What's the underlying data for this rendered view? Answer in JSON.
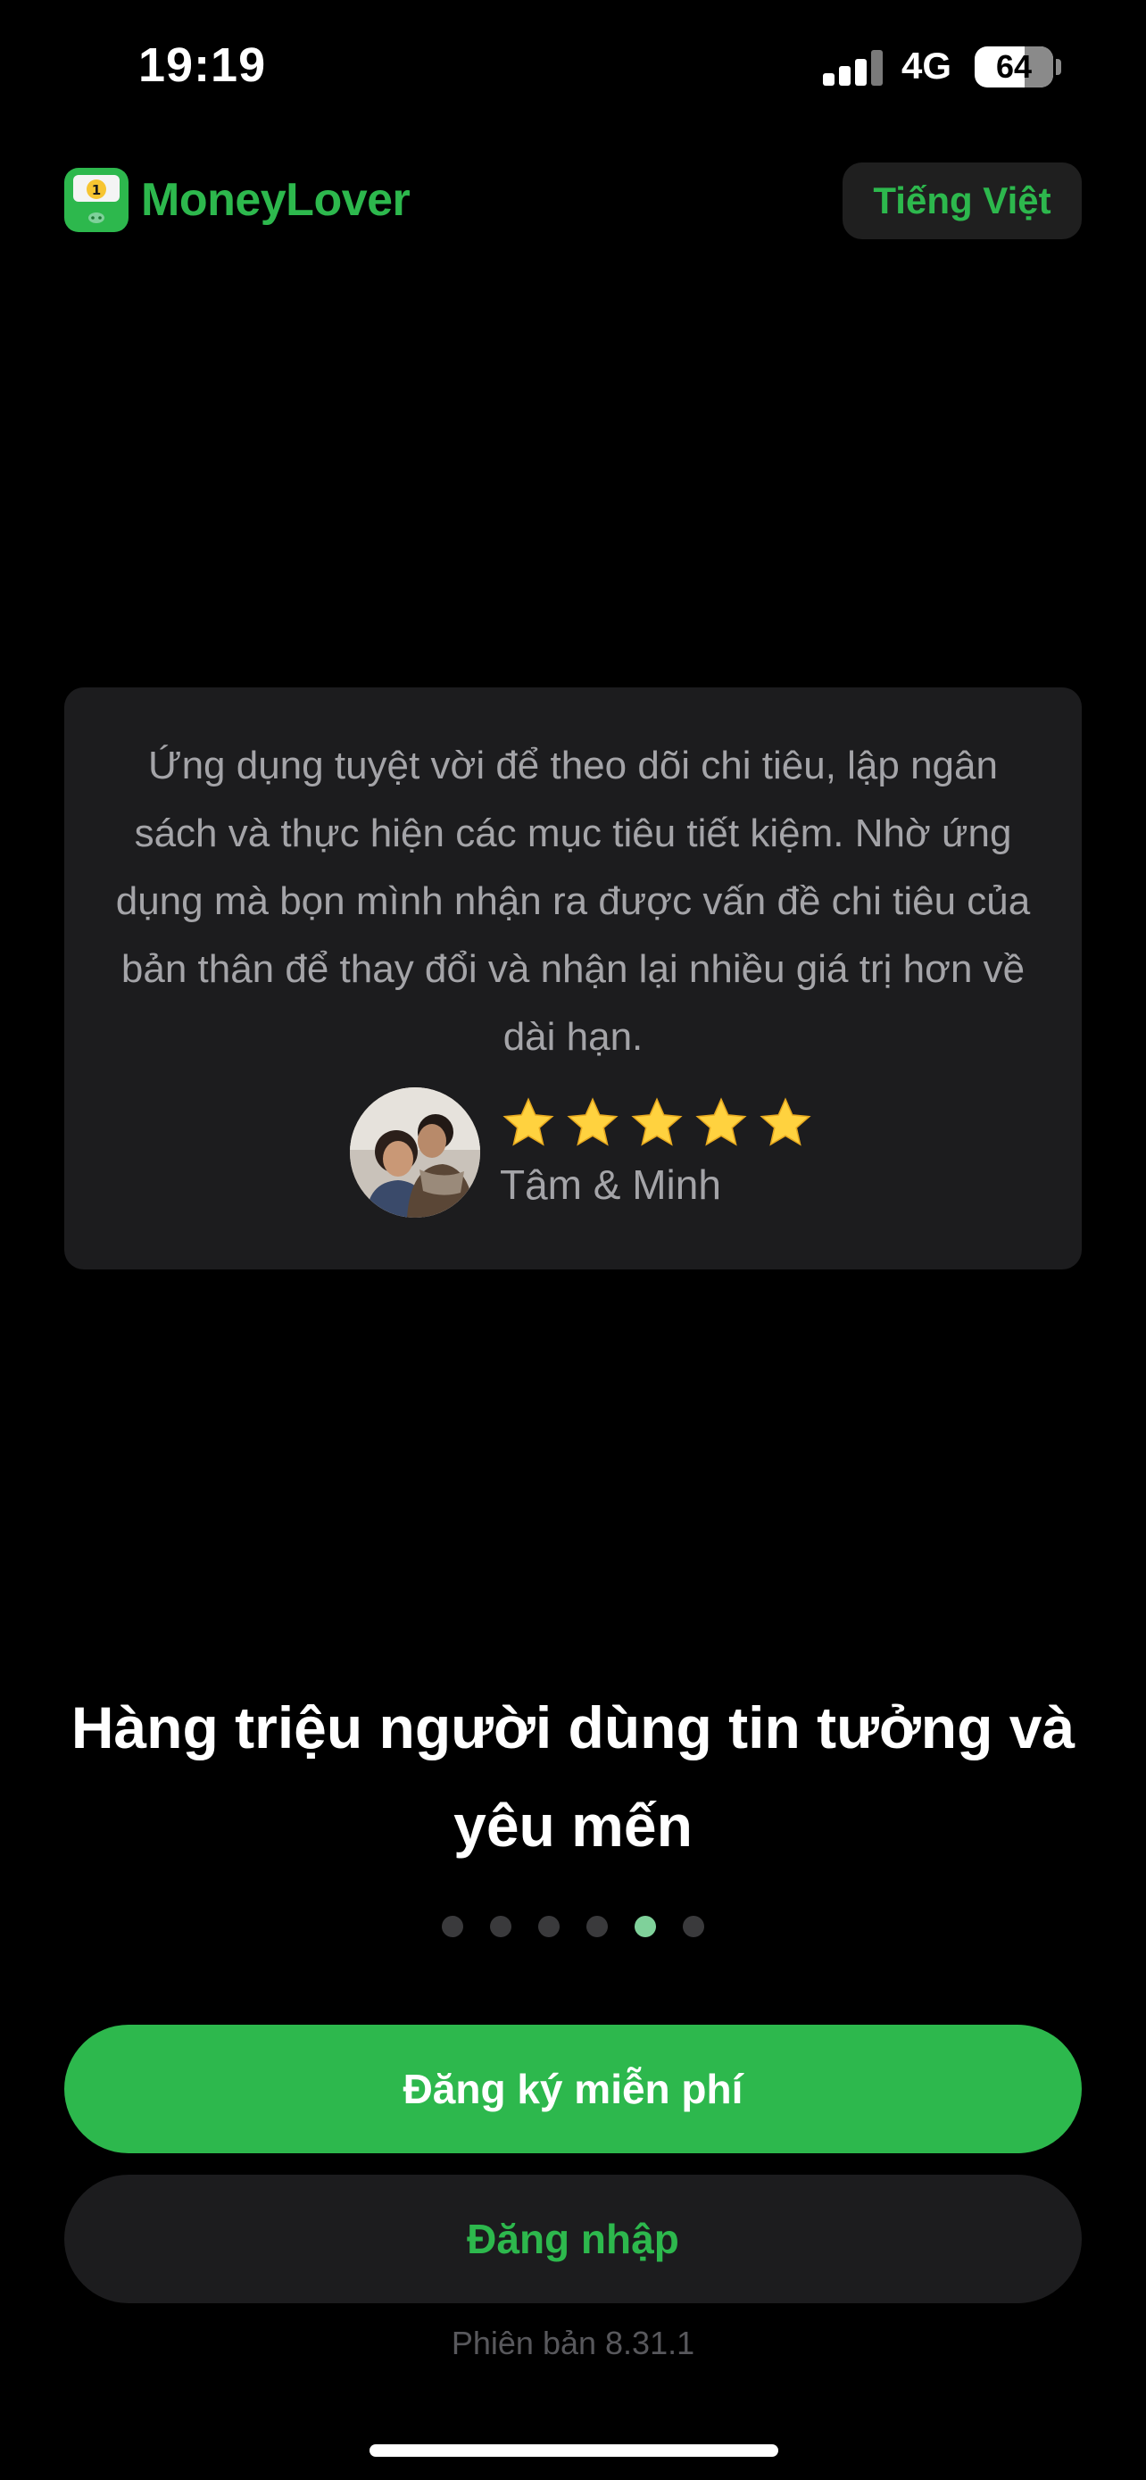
{
  "status_bar": {
    "time": "19:19",
    "network": "4G",
    "battery_level": "64"
  },
  "header": {
    "app_name": "MoneyLover",
    "language_button": "Tiếng Việt",
    "brand_color": "#2db84d"
  },
  "testimonial": {
    "quote": "Ứng dụng tuyệt vời để theo dõi chi tiêu, lập ngân sách và thực hiện các mục tiêu tiết kiệm. Nhờ ứng dụng mà bọn mình nhận ra được vấn đề chi tiêu của bản thân để thay đổi và nhận lại nhiều giá trị hơn về dài hạn.",
    "rating": 5,
    "rating_max": 5,
    "reviewer": "Tâm & Minh"
  },
  "onboarding": {
    "headline": "Hàng triệu người dùng tin tưởng và yêu mến",
    "page_count": 6,
    "active_page": 5
  },
  "actions": {
    "signup_label": "Đăng ký miễn phí",
    "login_label": "Đăng nhập"
  },
  "footer": {
    "version": "Phiên bản 8.31.1"
  }
}
